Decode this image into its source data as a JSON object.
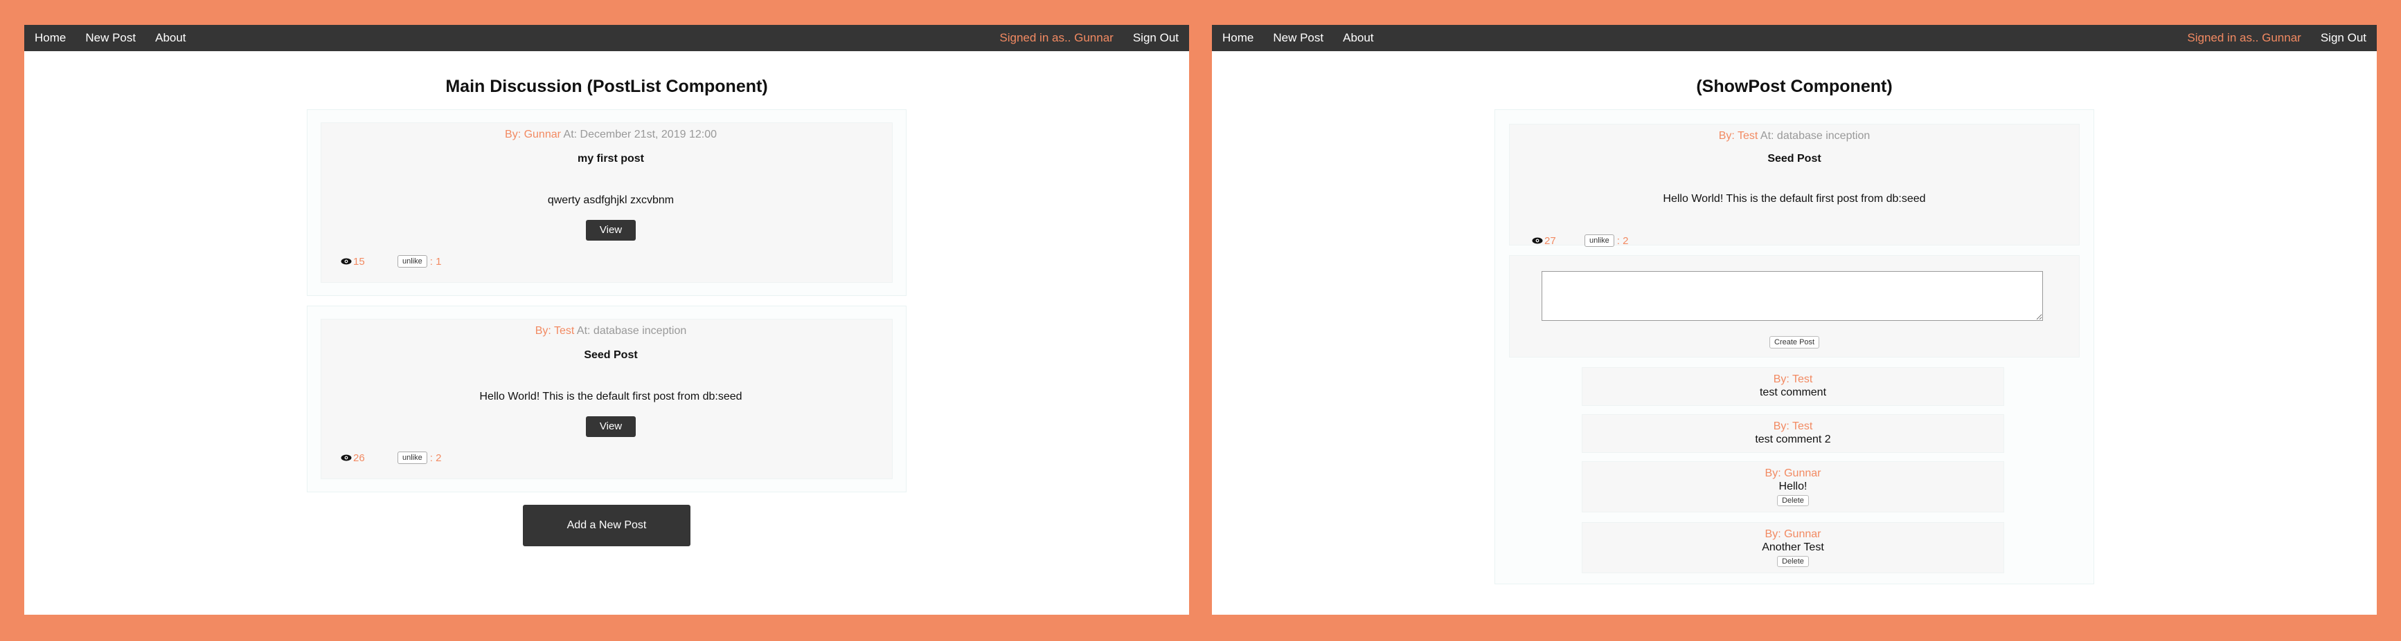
{
  "nav": {
    "home": "Home",
    "new_post": "New Post",
    "about": "About",
    "signed_in": "Signed in as.. Gunnar",
    "sign_out": "Sign Out"
  },
  "left": {
    "title": "Main Discussion (PostList Component)",
    "posts": [
      {
        "by_label": "By: Gunnar",
        "at_label": " At: December 21st, 2019 12:00",
        "title": "my first post",
        "body": "qwerty asdfghjkl zxcvbnm",
        "view_label": "View",
        "views": "15",
        "unlike_label": "unlike",
        "likes": ": 1"
      },
      {
        "by_label": "By: Test",
        "at_label": " At: database inception",
        "title": "Seed Post",
        "body": "Hello World! This is the default first post from db:seed",
        "view_label": "View",
        "views": "26",
        "unlike_label": "unlike",
        "likes": ": 2"
      }
    ],
    "add_post_label": "Add a New Post"
  },
  "right": {
    "title": "(ShowPost Component)",
    "post": {
      "by_label": "By: Test",
      "at_label": " At: database inception",
      "title": "Seed Post",
      "body": "Hello World! This is the default first post from db:seed",
      "views": "27",
      "unlike_label": "unlike",
      "likes": ": 2"
    },
    "comment_input_value": "",
    "create_post_label": "Create Post",
    "comments": [
      {
        "author": "By: Test",
        "text": "test comment",
        "delete_label": ""
      },
      {
        "author": "By: Test",
        "text": "test comment 2",
        "delete_label": ""
      },
      {
        "author": "By: Gunnar",
        "text": "Hello!",
        "delete_label": "Delete"
      },
      {
        "author": "By: Gunnar",
        "text": "Another Test",
        "delete_label": "Delete"
      }
    ]
  },
  "colors": {
    "accent": "#f28a62",
    "navbar": "#353535",
    "card": "#f7f7f7"
  }
}
